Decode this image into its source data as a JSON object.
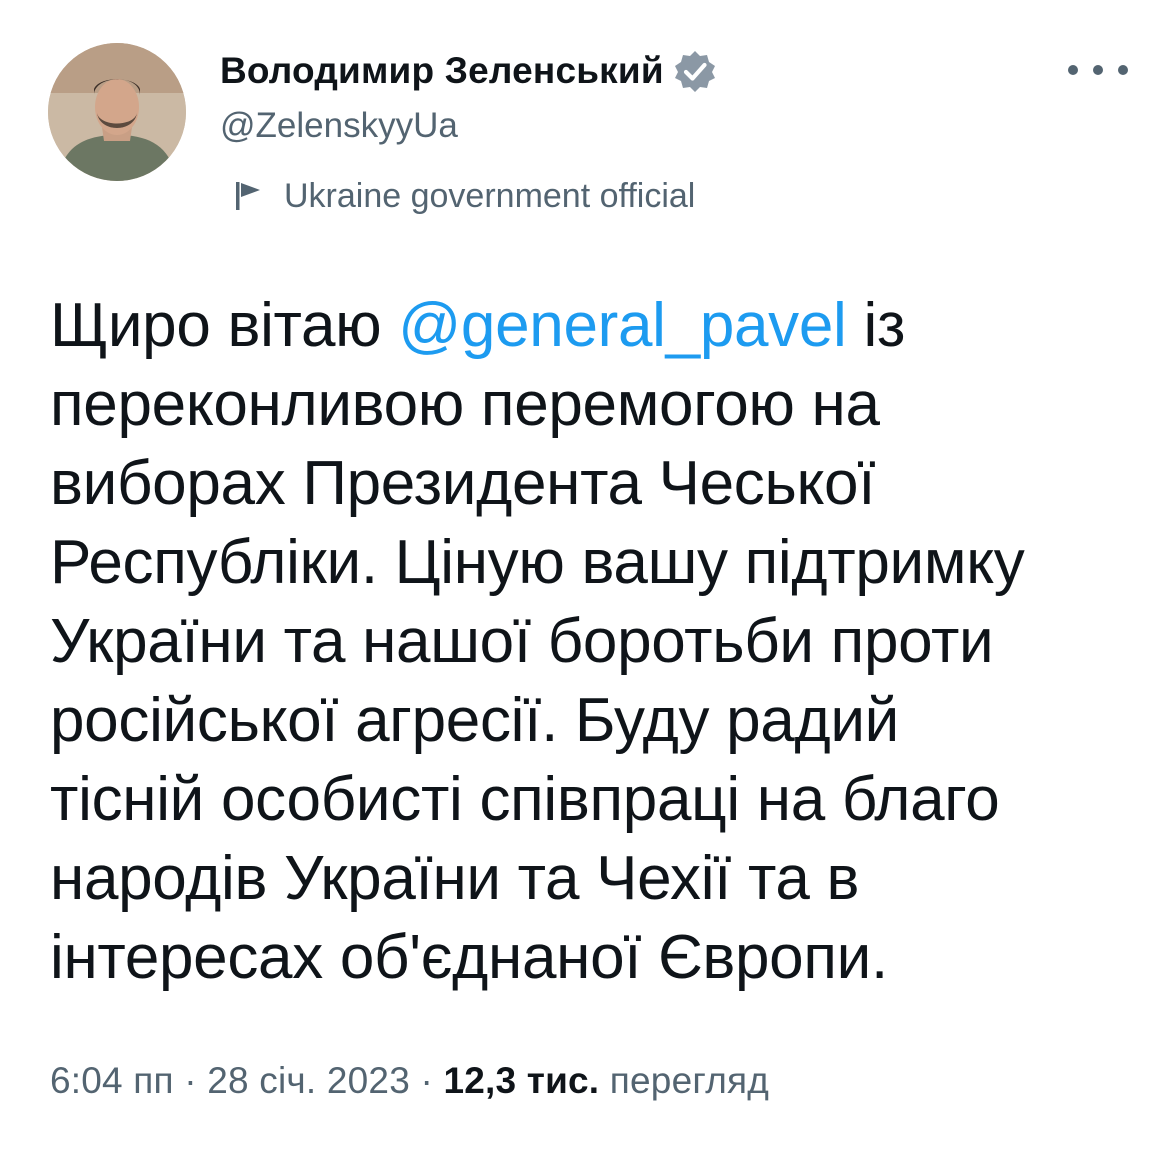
{
  "author": {
    "display_name": "Володимир Зеленський",
    "handle": "@ZelenskyyUa",
    "verified_icon": "verified-badge-icon",
    "label": "Ukraine government official",
    "label_icon": "flag-icon"
  },
  "menu": {
    "icon": "more-options-icon"
  },
  "tweet": {
    "lines": [
      {
        "before": "Щиро вітаю ",
        "mention": "@general_pavel",
        "after": " із"
      },
      {
        "text": "переконливою перемогою на"
      },
      {
        "text": "виборах Президента Чеської"
      },
      {
        "text": "Республіки. Ціную вашу підтримку"
      },
      {
        "text": "України та нашої боротьби проти"
      },
      {
        "text": "російської агресії. Буду радий"
      },
      {
        "text": "тісній особисті співпраці на благо"
      },
      {
        "text": "народів України та Чехії та в"
      },
      {
        "text": "інтересах об'єднаної Європи."
      }
    ]
  },
  "meta": {
    "time": "6:04 пп",
    "date": "28 січ. 2023",
    "separator": "·",
    "views_count": "12,3 тис.",
    "views_label": "перегляд"
  },
  "colors": {
    "accent": "#1d9bf0",
    "text": "#0f1419",
    "secondary": "#536471"
  }
}
